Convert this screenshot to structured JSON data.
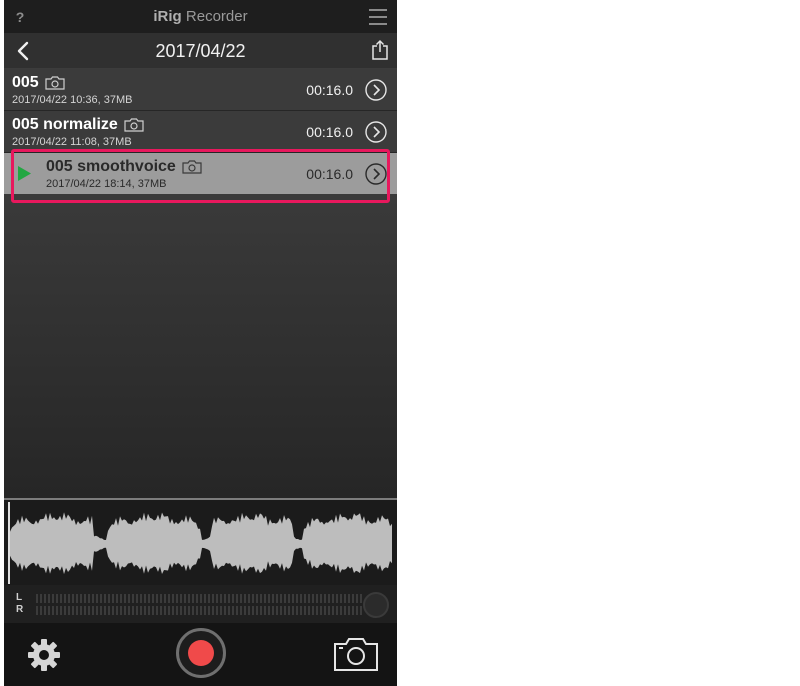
{
  "app": {
    "help_label": "?",
    "title_bold": "iRig",
    "title_rest": " Recorder"
  },
  "nav": {
    "title": "2017/04/22"
  },
  "recordings": [
    {
      "name": "005",
      "meta": "2017/04/22 10:36, 37MB",
      "duration": "00:16.0",
      "selected": false
    },
    {
      "name": "005 normalize",
      "meta": "2017/04/22 11:08, 37MB",
      "duration": "00:16.0",
      "selected": false
    },
    {
      "name": "005 smoothvoice",
      "meta": "2017/04/22 18:14, 37MB",
      "duration": "00:16.0",
      "selected": true
    }
  ],
  "meter": {
    "left_label": "L",
    "right_label": "R"
  },
  "colors": {
    "highlight": "#e8185d",
    "record": "#f04a4a",
    "play": "#22a742"
  },
  "icons": [
    "help-icon",
    "menu-icon",
    "back-chevron-icon",
    "share-icon",
    "camera-icon",
    "chevron-right-icon",
    "play-icon",
    "gear-icon",
    "record-icon"
  ]
}
